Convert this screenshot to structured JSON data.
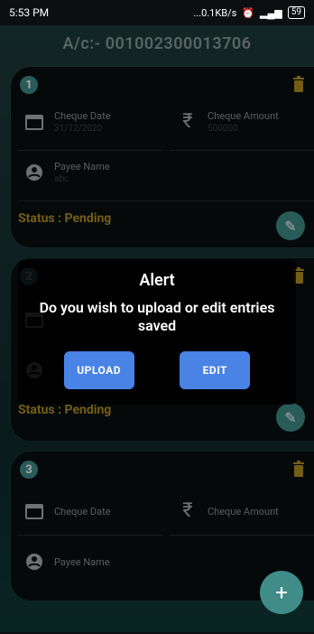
{
  "status_bar": {
    "time": "5:53 PM",
    "net_speed": "...0.1KB/s",
    "battery": "59"
  },
  "account": {
    "title": "A/c:- 001002300013706"
  },
  "cards": [
    {
      "number": "1",
      "cheque_date_label": "Cheque Date",
      "cheque_date_value": "31/12/2020",
      "cheque_amount_label": "Cheque Amount",
      "cheque_amount_value": "500000",
      "payee_name_label": "Payee Name",
      "payee_name_value": "abc",
      "status": "Status : Pending"
    },
    {
      "number": "2",
      "status": "Status : Pending"
    },
    {
      "number": "3",
      "cheque_date_label": "Cheque Date",
      "cheque_amount_label": "Cheque Amount",
      "payee_name_label": "Payee Name"
    }
  ],
  "dialog": {
    "title": "Alert",
    "message": "Do you wish to upload or edit entries saved",
    "upload_label": "UPLOAD",
    "edit_label": "EDIT"
  },
  "fab": {
    "label": "+"
  },
  "colors": {
    "accent": "#3f8c88",
    "status": "#b38f23",
    "button": "#4a83e6"
  }
}
